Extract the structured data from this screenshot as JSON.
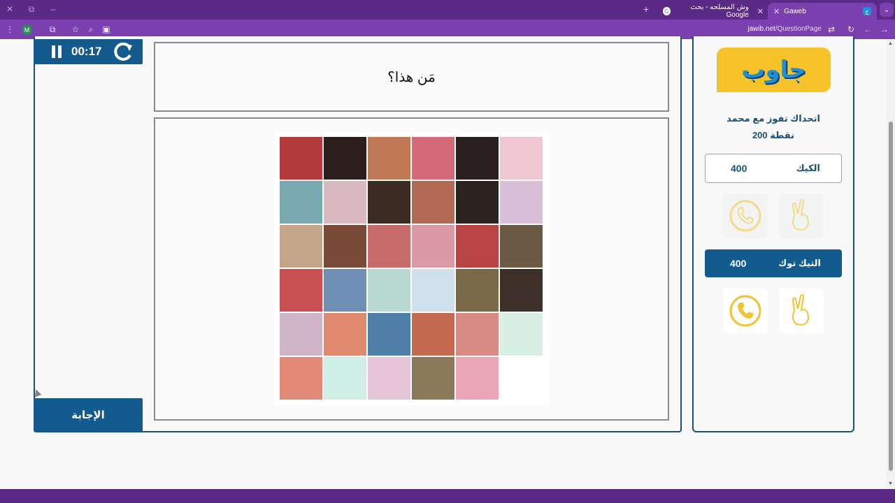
{
  "browser": {
    "tabs": [
      {
        "title": "Gaweb",
        "active": true
      },
      {
        "title": "وش المسلحه - بحث Google",
        "active": false
      }
    ],
    "url_host": "jawib.net",
    "url_path": "/QuestionPage",
    "profile_initial": "M"
  },
  "game": {
    "timer": "00:17",
    "question": "مَن هذا؟",
    "answer_button": "الإجابة"
  },
  "sidebar": {
    "logo_text": "جاوب",
    "challenge_line1": "اتحداك تفوز مع محمد",
    "challenge_line2": "200 نقطة",
    "teams": [
      {
        "name": "الكيك",
        "score": "400",
        "helps_used": true
      },
      {
        "name": "التيك توك",
        "score": "400",
        "helps_used": false
      }
    ]
  },
  "colors": {
    "brand_purple": "#7b3fb0",
    "primary_blue": "#135a8e",
    "logo_yellow": "#f6c42a",
    "help_icon_gold": "#f2c230"
  },
  "puzzle": {
    "tiles": [
      [
        "#b33a3a",
        "#2b1d1a",
        "#c07855",
        "#d46a7a",
        "#2a2020",
        "#f0c6d2"
      ],
      [
        "#79a9b0",
        "#d9b8c2",
        "#3a2a22",
        "#b36a55",
        "#2b2320",
        "#d8bfd8"
      ],
      [
        "#c4a68b",
        "#7a4a38",
        "#c66a6a",
        "#d99aa5",
        "#b84545",
        "#6b5a44"
      ],
      [
        "#c95050",
        "#6f8fb5",
        "#b9d8d0",
        "#cfe0ea",
        "#7a6a4a",
        "#3d3028"
      ],
      [
        "#d0b4c8",
        "#e08a70",
        "#4f7fa6",
        "#c56a50",
        "#d88a85",
        "#d7efe5"
      ],
      [
        "#e28a78",
        "#cfeee6",
        "#e6c6d6",
        "#8a7a5a",
        "#e9a6b6",
        "#ffffff"
      ]
    ]
  }
}
